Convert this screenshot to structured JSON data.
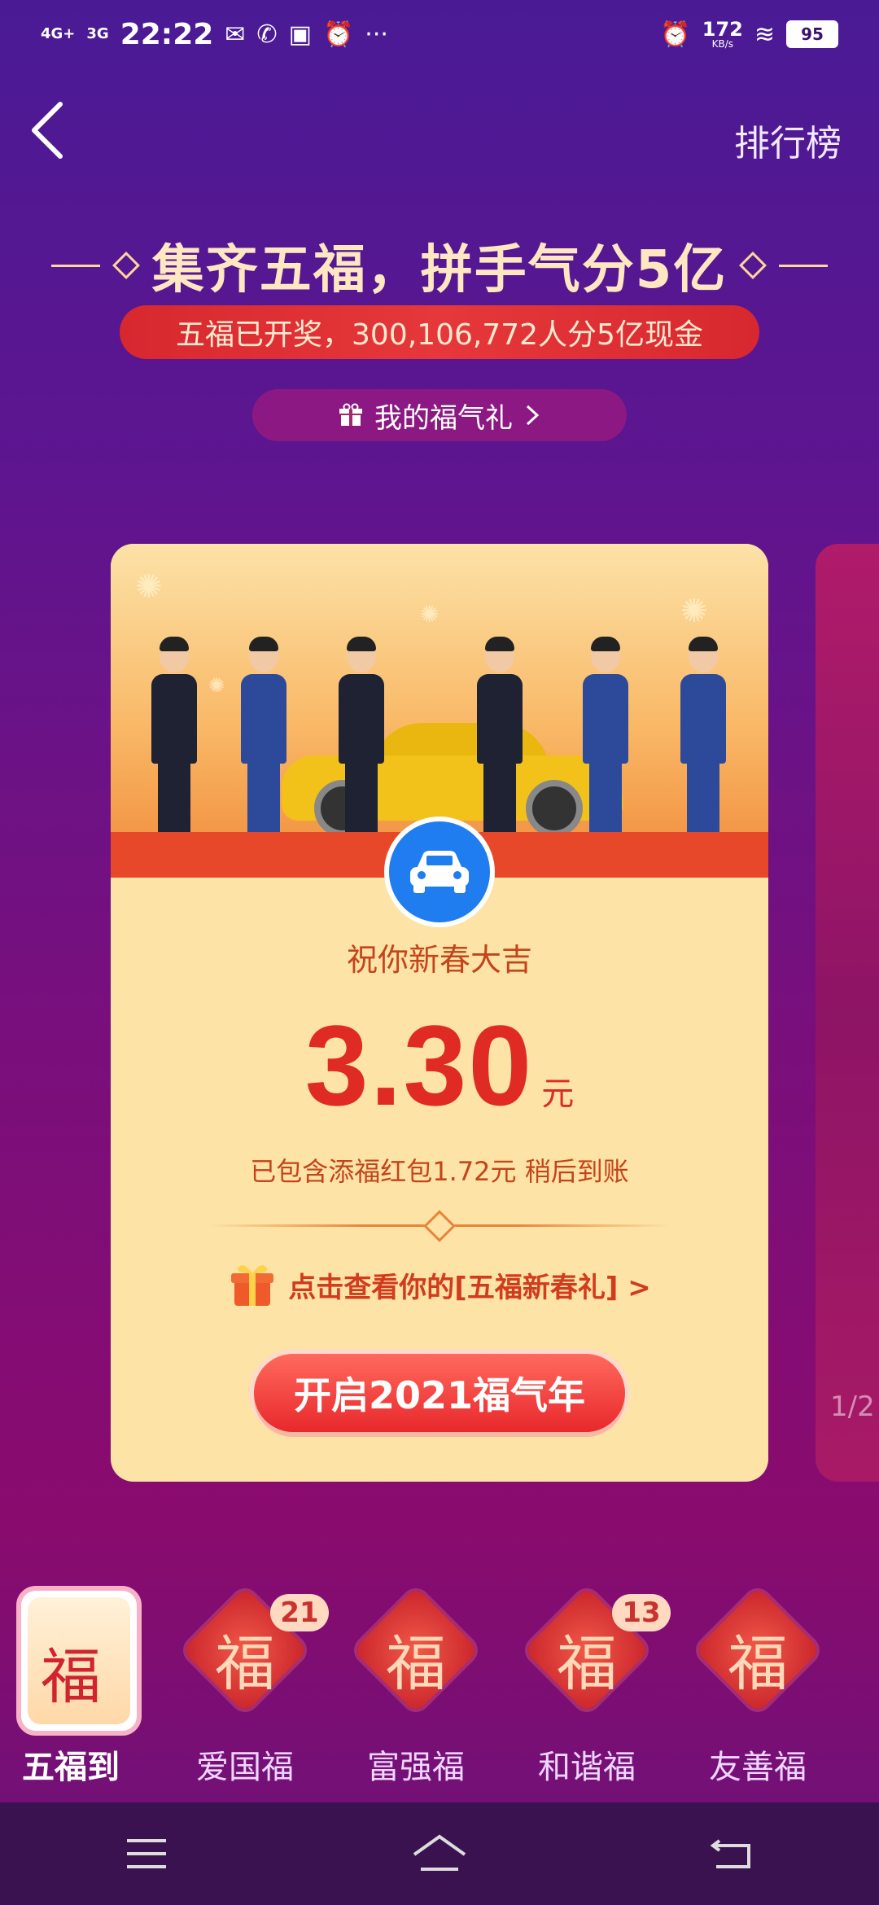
{
  "status_bar": {
    "network_1": "4G+",
    "network_2": "3G",
    "time": "22:22",
    "extra": "···",
    "speed_value": "172",
    "speed_unit": "KB/s",
    "battery": "95"
  },
  "topnav": {
    "ranking_label": "排行榜"
  },
  "headline": {
    "title": "集齐五福，拼手气分5亿",
    "notice": "五福已开奖，300,106,772人分5亿现金",
    "my_gift": "我的福气礼"
  },
  "card": {
    "wish": "祝你新春大吉",
    "amount": "3.30",
    "unit": "元",
    "detail": "已包含添福红包1.72元 稍后到账",
    "link_text": "点击查看你的[五福新春礼] >",
    "cta": "开启2021福气年",
    "badge_icon": "car-icon"
  },
  "peek_card": {
    "counter": "1/2"
  },
  "tabs": [
    {
      "label": "五福到",
      "glyph": "福",
      "badge": "",
      "active": true
    },
    {
      "label": "爱国福",
      "glyph": "福",
      "badge": "21",
      "active": false
    },
    {
      "label": "富强福",
      "glyph": "福",
      "badge": "",
      "active": false
    },
    {
      "label": "和谐福",
      "glyph": "福",
      "badge": "13",
      "active": false
    },
    {
      "label": "友善福",
      "glyph": "福",
      "badge": "",
      "active": false
    }
  ],
  "colors": {
    "accent_red": "#e02a24",
    "card_bg": "#fde3a6",
    "bg_purple": "#5e158f"
  }
}
